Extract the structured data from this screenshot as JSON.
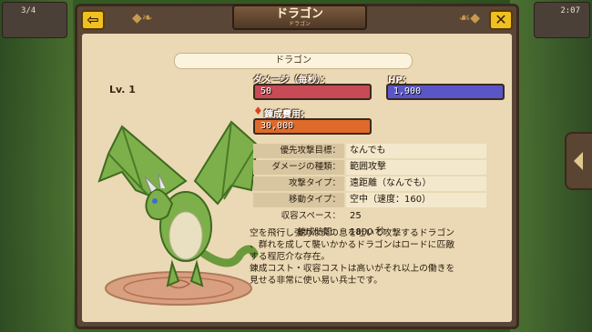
{
  "hud": {
    "left_text": "3/4",
    "right_text": "2:07"
  },
  "window": {
    "title": "ドラゴン",
    "title_sub": "ドラゴン",
    "back_icon": "back-arrow-icon",
    "close_icon": "close-x-icon"
  },
  "unit": {
    "name": "ドラゴン",
    "level": "Lv. 1"
  },
  "stats": {
    "damage_label": "ダメージ（毎秒）：",
    "damage_value": "50",
    "damage_color": "#c84a56",
    "hp_label": "HP：",
    "hp_value": "1,900",
    "hp_color": "#5a56c8",
    "cost_label": "錬成費用：",
    "cost_value": "30,000",
    "cost_color": "#e06a2a"
  },
  "details": [
    {
      "key": "優先攻撃目標：",
      "value": "なんでも"
    },
    {
      "key": "ダメージの種類：",
      "value": "範囲攻撃"
    },
    {
      "key": "攻撃タイプ：",
      "value": "遠距離（なんでも）"
    },
    {
      "key": "移動タイプ：",
      "value": "空中（速度：160）"
    },
    {
      "key": "収容スペース：",
      "value": "25"
    },
    {
      "key": "錬成時間：",
      "value": "1800 秒"
    }
  ],
  "description": [
    "空を飛行し強力な炎の息を吐いて攻撃するドラゴン",
    "、群れを成して襲いかかるドラゴンはロードに匹敵",
    "する程厄介な存在。",
    "錬成コスト・収容コストは高いがそれ以上の働きを",
    "見せる非常に使い易い兵士です。"
  ]
}
